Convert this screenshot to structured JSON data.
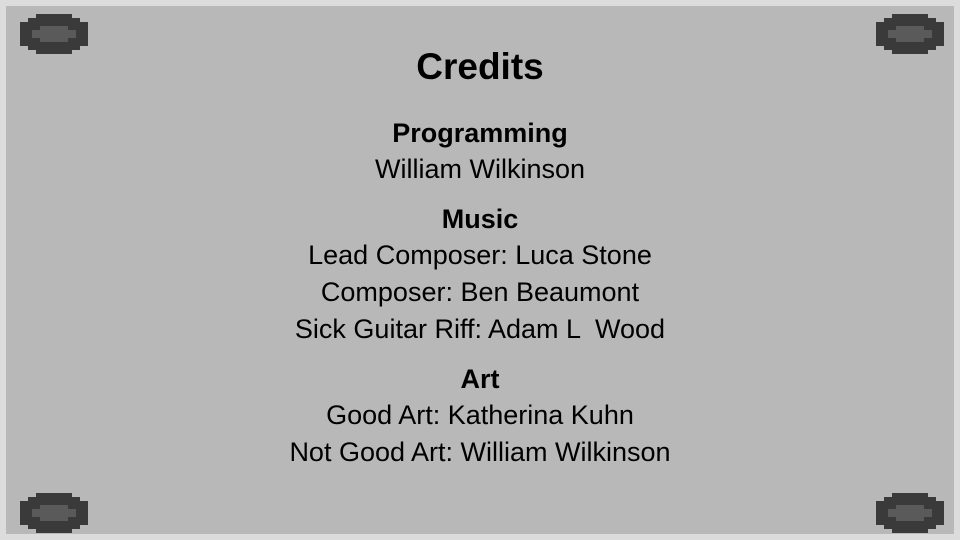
{
  "title": "Credits",
  "sections": [
    {
      "heading": "Programming",
      "lines": [
        "William Wilkinson"
      ]
    },
    {
      "heading": "Music",
      "lines": [
        "Lead Composer: Luca Stone",
        "Composer: Ben Beaumont",
        "Sick Guitar Riff: Adam L  Wood"
      ]
    },
    {
      "heading": "Art",
      "lines": [
        "Good Art: Katherina Kuhn",
        "Not Good Art: William Wilkinson"
      ]
    }
  ],
  "colors": {
    "background": "#b8b8b8",
    "frame": "#dcdcdc",
    "ornament_dark": "#3a3a3a",
    "ornament_mid": "#5a5a5a",
    "text": "#000000"
  },
  "icons": {
    "corner_ornament": "pixel-gem-icon"
  }
}
